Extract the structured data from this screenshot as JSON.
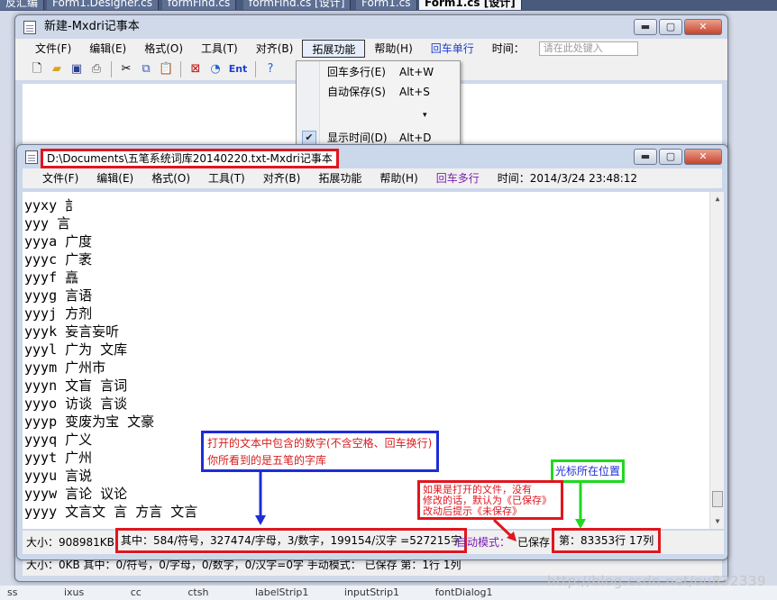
{
  "ide_tabs": [
    "反汇编",
    "Form1.Designer.cs",
    "formFind.cs",
    "formFind.cs [设计]",
    "Form1.cs",
    "Form1.cs [设计]"
  ],
  "back_window": {
    "title": "新建-Mxdri记事本",
    "menus": [
      "文件(F)",
      "编辑(E)",
      "格式(O)",
      "工具(T)",
      "对齐(B)",
      "拓展功能",
      "帮助(H)",
      "回车单行",
      "时间："
    ],
    "time_placeholder": "请在此处键入",
    "toolbar_icons": [
      "new-icon",
      "open-icon",
      "save-icon",
      "print-icon",
      "cut-icon",
      "copy-icon",
      "paste-icon",
      "clear-icon",
      "time-icon",
      "enter-icon",
      "help-icon"
    ],
    "toolbar_glyph_ent": "Ent",
    "status": "大小：0KB  其中：0/符号，0/字母，0/数字，0/汉字=0字  手动模式：  已保存  第：1行 1列"
  },
  "dropdown": {
    "items": [
      {
        "label": "回车多行(E)",
        "shortcut": "Alt+W"
      },
      {
        "label": "自动保存(S)",
        "shortcut": "Alt+S"
      },
      {
        "label": "",
        "shortcut": "▾"
      },
      {
        "label": "显示时间(D)",
        "shortcut": "Alt+D",
        "checked": true
      }
    ]
  },
  "front_window": {
    "title": "D:\\Documents\\五笔系统词库20140220.txt-Mxdri记事本",
    "menus": [
      "文件(F)",
      "编辑(E)",
      "格式(O)",
      "工具(T)",
      "对齐(B)",
      "拓展功能",
      "帮助(H)",
      "回车多行",
      "时间：2014/3/24 23:48:12"
    ],
    "lines": [
      "yyxy 訁",
      "yyy 言",
      "yyya 广度",
      "yyyc 广袤",
      "yyyf 譶",
      "yyyg 言语",
      "yyyj 方剂",
      "yyyk 妄言妄听",
      "yyyl 广为 文库",
      "yyym 广州市",
      "yyyn 文盲 言词",
      "yyyo 访谈 言谈",
      "yyyp 变废为宝 文豪",
      "yyyq 广义",
      "yyyt 广州",
      "yyyu 言说",
      "yyyw 言论 议论",
      "yyyy 文言文 言 方言 文言"
    ],
    "status": {
      "size": "大小：908981KB",
      "counts": "其中：584/符号，327474/字母，3/数字，199154/汉字 =527215字",
      "mode": "自动模式：",
      "saved": "已保存",
      "position": "第：83353行 17列"
    }
  },
  "annotations": {
    "counts_line1": "打开的文本中包含的数字(不含空格、回车换行)",
    "counts_line2": "你所看到的是五笔的字库",
    "cursor": "光标所在位置",
    "save_line1": "如果是打开的文件，没有",
    "save_line2": "修改的话，默认为《已保存》",
    "save_line3": "改动后提示《未保存》"
  },
  "watermark": "http://blog.csdn.net/ou832339",
  "bottom_items": [
    "ss",
    "ixus",
    "cc",
    "ctsh",
    "labelStrip1",
    "inputStrip1",
    "fontDialog1"
  ]
}
